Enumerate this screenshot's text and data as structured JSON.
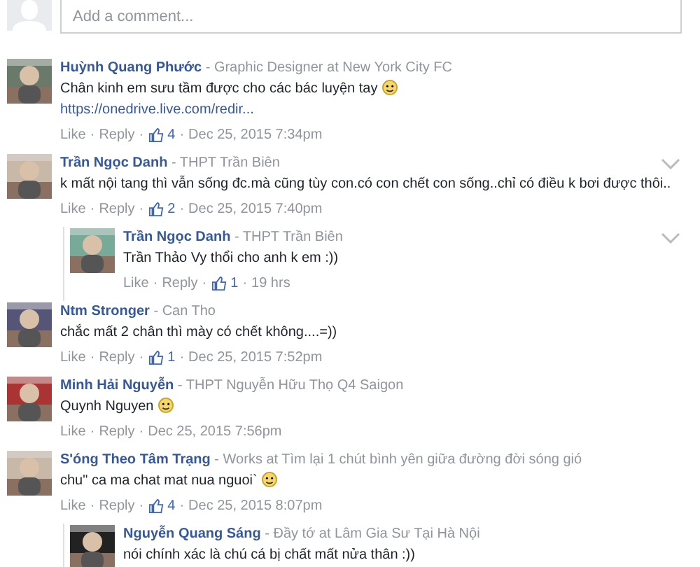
{
  "composer": {
    "placeholder": "Add a comment..."
  },
  "separator": "·",
  "meta_separator": "-",
  "comments": [
    {
      "name": "Huỳnh Quang Phước",
      "meta": "Graphic Designer at New York City FC",
      "text": "Chân kinh em sưu tầm được cho các bác luyện tay",
      "emoji": true,
      "link": "https://onedrive.live.com/redir...",
      "like": "Like",
      "reply": "Reply",
      "likes": "4",
      "time": "Dec 25, 2015 7:34pm",
      "menu": false
    },
    {
      "name": "Trần Ngọc Danh",
      "meta": "THPT Trần Biên",
      "text": "k mất nội tang thì vẫn sống đc.mà cũng tùy con.có con chết con sống..chỉ có điều k bơi được thôi..",
      "emoji": false,
      "like": "Like",
      "reply": "Reply",
      "likes": "2",
      "time": "Dec 25, 2015 7:40pm",
      "menu": true,
      "children": [
        {
          "name": "Trần Ngọc Danh",
          "meta": "THPT Trần Biên",
          "text": "Trần Thảo Vy thổi cho anh k em :))",
          "emoji": false,
          "like": "Like",
          "reply": "Reply",
          "likes": "1",
          "time": "19 hrs",
          "menu": true
        }
      ]
    },
    {
      "name": "Ntm Stronger",
      "meta": "Can Tho",
      "text": "chắc mất 2 chân thì mày có chết không....=))",
      "emoji": false,
      "like": "Like",
      "reply": "Reply",
      "likes": "1",
      "time": "Dec 25, 2015 7:52pm",
      "menu": false
    },
    {
      "name": "Minh Hải Nguyễn",
      "meta": "THPT Nguyễn Hữu Thọ Q4 Saigon",
      "text": "Quynh Nguyen",
      "emoji": true,
      "like": "Like",
      "reply": "Reply",
      "time": "Dec 25, 2015 7:56pm",
      "menu": false
    },
    {
      "name": "S'óng Theo Tâm Trạng",
      "meta": "Works at Tìm lại 1 chút bình yên giữa đường đời sóng gió",
      "text": "chu\" ca ma chat mat nua nguoi`",
      "emoji": true,
      "like": "Like",
      "reply": "Reply",
      "likes": "4",
      "time": "Dec 25, 2015 8:07pm",
      "menu": false,
      "children": [
        {
          "name": "Nguyễn Quang Sáng",
          "meta": "Đầy tớ at Lâm Gia Sư Tại Hà Nội",
          "text": "nói chính xác là chú cá bị chất mất nửa thân :))",
          "emoji": false,
          "menu": false
        }
      ]
    }
  ]
}
